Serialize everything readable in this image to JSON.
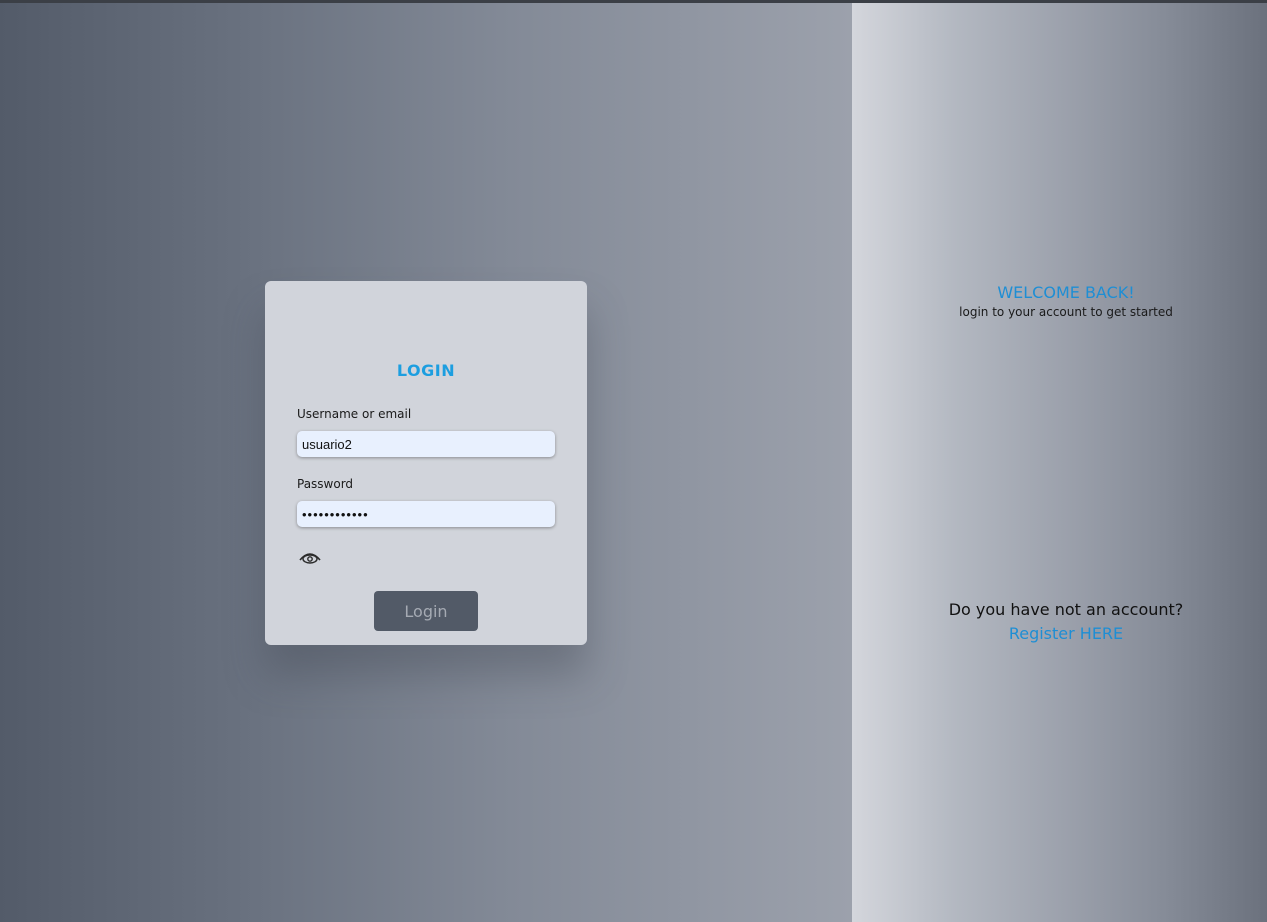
{
  "login": {
    "title": "LOGIN",
    "username_label": "Username or email",
    "username_value": "usuario2",
    "password_label": "Password",
    "password_value": "••••••••••••",
    "toggle_icon": "eye-icon",
    "button_label": "Login"
  },
  "side": {
    "welcome_title": "WELCOME BACK!",
    "welcome_subtitle": "login to your account to get started",
    "no_account_text": "Do you have not an account?",
    "register_link": "Register HERE"
  },
  "colors": {
    "accent": "#1c9ee0",
    "button_bg": "#525a67",
    "input_bg": "#e8f0fe"
  }
}
